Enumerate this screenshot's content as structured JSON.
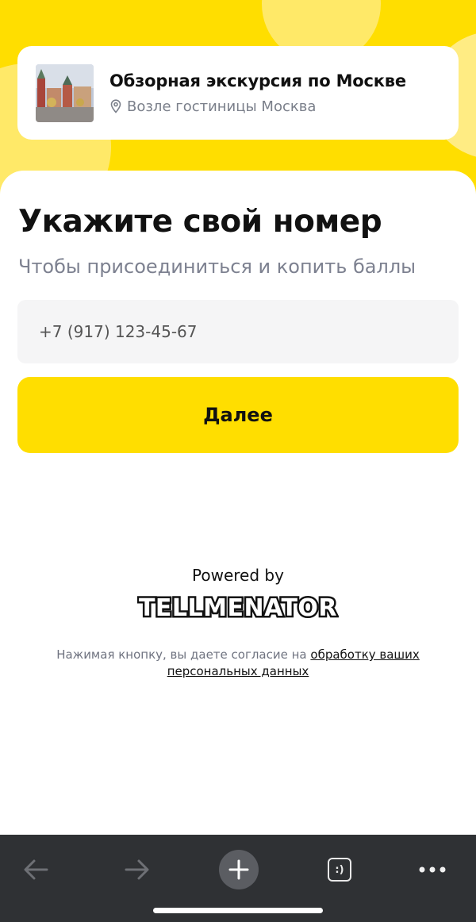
{
  "tour": {
    "title": "Обзорная экскурсия по Москве",
    "location": "Возле гостиницы Москва"
  },
  "form": {
    "heading": "Укажите свой номер",
    "subheading": "Чтобы присоединиться и копить баллы",
    "phone_placeholder": "+7 (917) 123-45-67",
    "next_label": "Далее"
  },
  "footer": {
    "powered_by": "Powered by",
    "brand": "TELLMENATOR",
    "consent_text": "Нажимая кнопку, вы даете согласие на ",
    "consent_link": "обработку ваших персональных данных"
  },
  "toolbar": {
    "back_icon": "arrow-left-icon",
    "forward_icon": "arrow-right-icon",
    "new_tab_icon": "plus-icon",
    "tabs_label": ":)",
    "menu_icon": "more-dots-icon"
  },
  "colors": {
    "accent": "#ffde00",
    "toolbar": "#2f3134"
  }
}
